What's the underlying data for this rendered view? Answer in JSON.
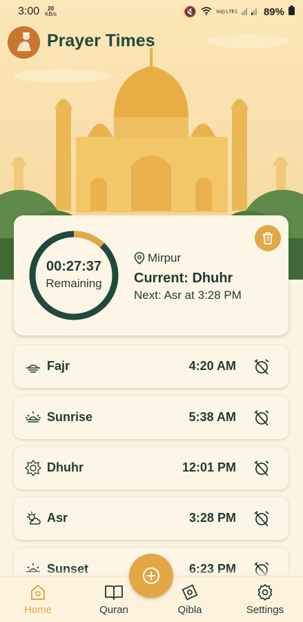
{
  "status": {
    "time": "3:00",
    "speed_value": "20",
    "speed_unit": "KB/s",
    "network": "Vo)) LTE1",
    "battery": "89%"
  },
  "app": {
    "title": "Prayer Times"
  },
  "countdown": {
    "time": "00:27:37",
    "label": "Remaining",
    "progress": 0.12
  },
  "location": {
    "name": "Mirpur"
  },
  "current": {
    "text": "Current: Dhuhr"
  },
  "next": {
    "text": "Next: Asr at 3:28 PM"
  },
  "prayers": [
    {
      "name": "Fajr",
      "time": "4:20 AM"
    },
    {
      "name": "Sunrise",
      "time": "5:38 AM"
    },
    {
      "name": "Dhuhr",
      "time": "12:01 PM"
    },
    {
      "name": "Asr",
      "time": "3:28 PM"
    },
    {
      "name": "Sunset",
      "time": "6:23 PM"
    }
  ],
  "nav": {
    "home": "Home",
    "quran": "Quran",
    "qibla": "Qibla",
    "settings": "Settings"
  },
  "colors": {
    "accent": "#e3a845",
    "dark_green": "#1f4a3d",
    "nav_active": "#e3a845"
  }
}
